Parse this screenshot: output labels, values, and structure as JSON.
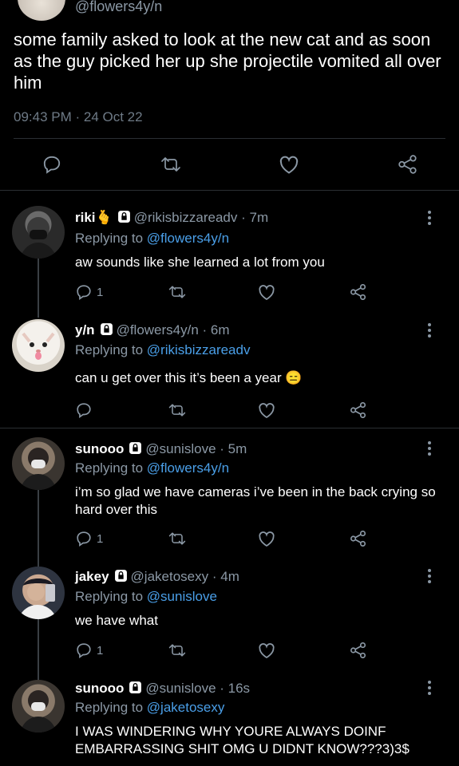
{
  "main_tweet": {
    "handle": "@flowers4y/n",
    "text": "some family asked to look at the new cat and as soon as the guy picked her up she projectile vomited all over him",
    "timestamp": "09:43 PM · 24 Oct 22"
  },
  "replies": [
    {
      "name": "riki",
      "emoji": "🫰",
      "handle": "@rikisbizzareadv",
      "time": "· 7m",
      "replying_prefix": "Replying to ",
      "replying_to": "@flowers4y/n",
      "text": "aw sounds like she learned a lot from you",
      "reply_count": "1",
      "avatar": "masked-person-avatar"
    },
    {
      "name": "y/n",
      "handle": "@flowers4y/n",
      "time": "· 6m",
      "replying_prefix": "Replying to ",
      "replying_to": "@rikisbizzareadv",
      "text": "can u get over this it’s been a year 😑",
      "reply_count": "",
      "avatar": "cat-avatar"
    },
    {
      "name": "sunooo",
      "handle": "@sunislove",
      "time": "· 5m",
      "replying_prefix": "Replying to ",
      "replying_to": "@flowers4y/n",
      "text": "i’m so glad we have cameras i’ve been in the back crying so hard over this",
      "reply_count": "1",
      "avatar": "person-mask-avatar"
    },
    {
      "name": "jakey",
      "handle": "@jaketosexy",
      "time": "· 4m",
      "replying_prefix": "Replying to ",
      "replying_to": "@sunislove",
      "text": "we have what",
      "reply_count": "1",
      "avatar": "person-phone-avatar"
    },
    {
      "name": "sunooo",
      "handle": "@sunislove",
      "time": "· 16s",
      "replying_prefix": "Replying to ",
      "replying_to": "@jaketosexy",
      "text": "I WAS WINDERING WHY YOURE ALWAYS DOINF EMBARRASSING SHIT OMG U DIDNT KNOW???3)3$",
      "reply_count": "",
      "avatar": "person-mask-avatar"
    }
  ],
  "colors": {
    "background": "#000000",
    "text": "#ffffff",
    "muted": "#8b98a5",
    "link": "#4a9fe8",
    "divider": "#2b2f33"
  }
}
